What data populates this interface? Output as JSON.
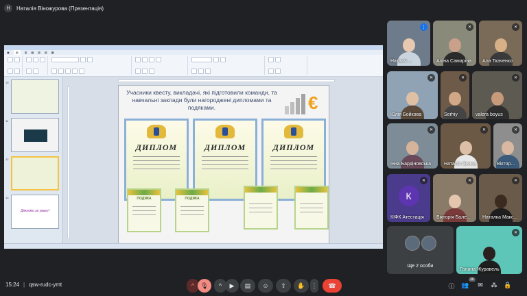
{
  "meeting": {
    "presenter_label": "Наталія Віножурова (Презентація)",
    "time": "15:24",
    "code": "qsw-rudc-ymt",
    "participants_badge": "36"
  },
  "slide": {
    "heading": "Учасники квесту, викладачі, які підготовили команди, та навчальні заклади були нагороджені дипломами та подяками.",
    "diploma_label": "ДИПЛОМ",
    "podyaka_label": "ПОДЯКА"
  },
  "thumbs": {
    "nums": [
      "10",
      "11",
      "12",
      "13"
    ],
    "last_text": "Дякуємо за увагу!"
  },
  "participants": [
    {
      "name": "Наталя ..."
    },
    {
      "name": "Аліна Самаріна"
    },
    {
      "name": "Ала Ткаченко"
    },
    {
      "name": "Юлія Бойкова"
    },
    {
      "name": "Serhiy"
    },
    {
      "name": "valera boyus"
    },
    {
      "name": "Інна Бардіновська"
    },
    {
      "name": "Наталія Зенна"
    },
    {
      "name": "Віктор..."
    },
    {
      "name": "КІФК Атестація",
      "letter": "К"
    },
    {
      "name": "Вікторія Бале..."
    },
    {
      "name": "Наталка Макс..."
    },
    {
      "name": "Ще 2 особи"
    },
    {
      "name": "Галина Журавель"
    }
  ],
  "colors": {
    "bg": "#202124",
    "hangup": "#ea4335",
    "accent_purple": "#5e35b1"
  },
  "icons": {
    "mic": "microphone-off-icon",
    "camera": "camera-icon",
    "captions": "captions-icon",
    "emoji": "emoji-icon",
    "present": "present-icon",
    "hand": "raise-hand-icon",
    "more": "more-options-icon",
    "hangup": "hangup-icon",
    "info": "info-icon",
    "people": "people-icon",
    "chat": "chat-icon",
    "activities": "activities-icon",
    "lock": "host-controls-icon"
  }
}
